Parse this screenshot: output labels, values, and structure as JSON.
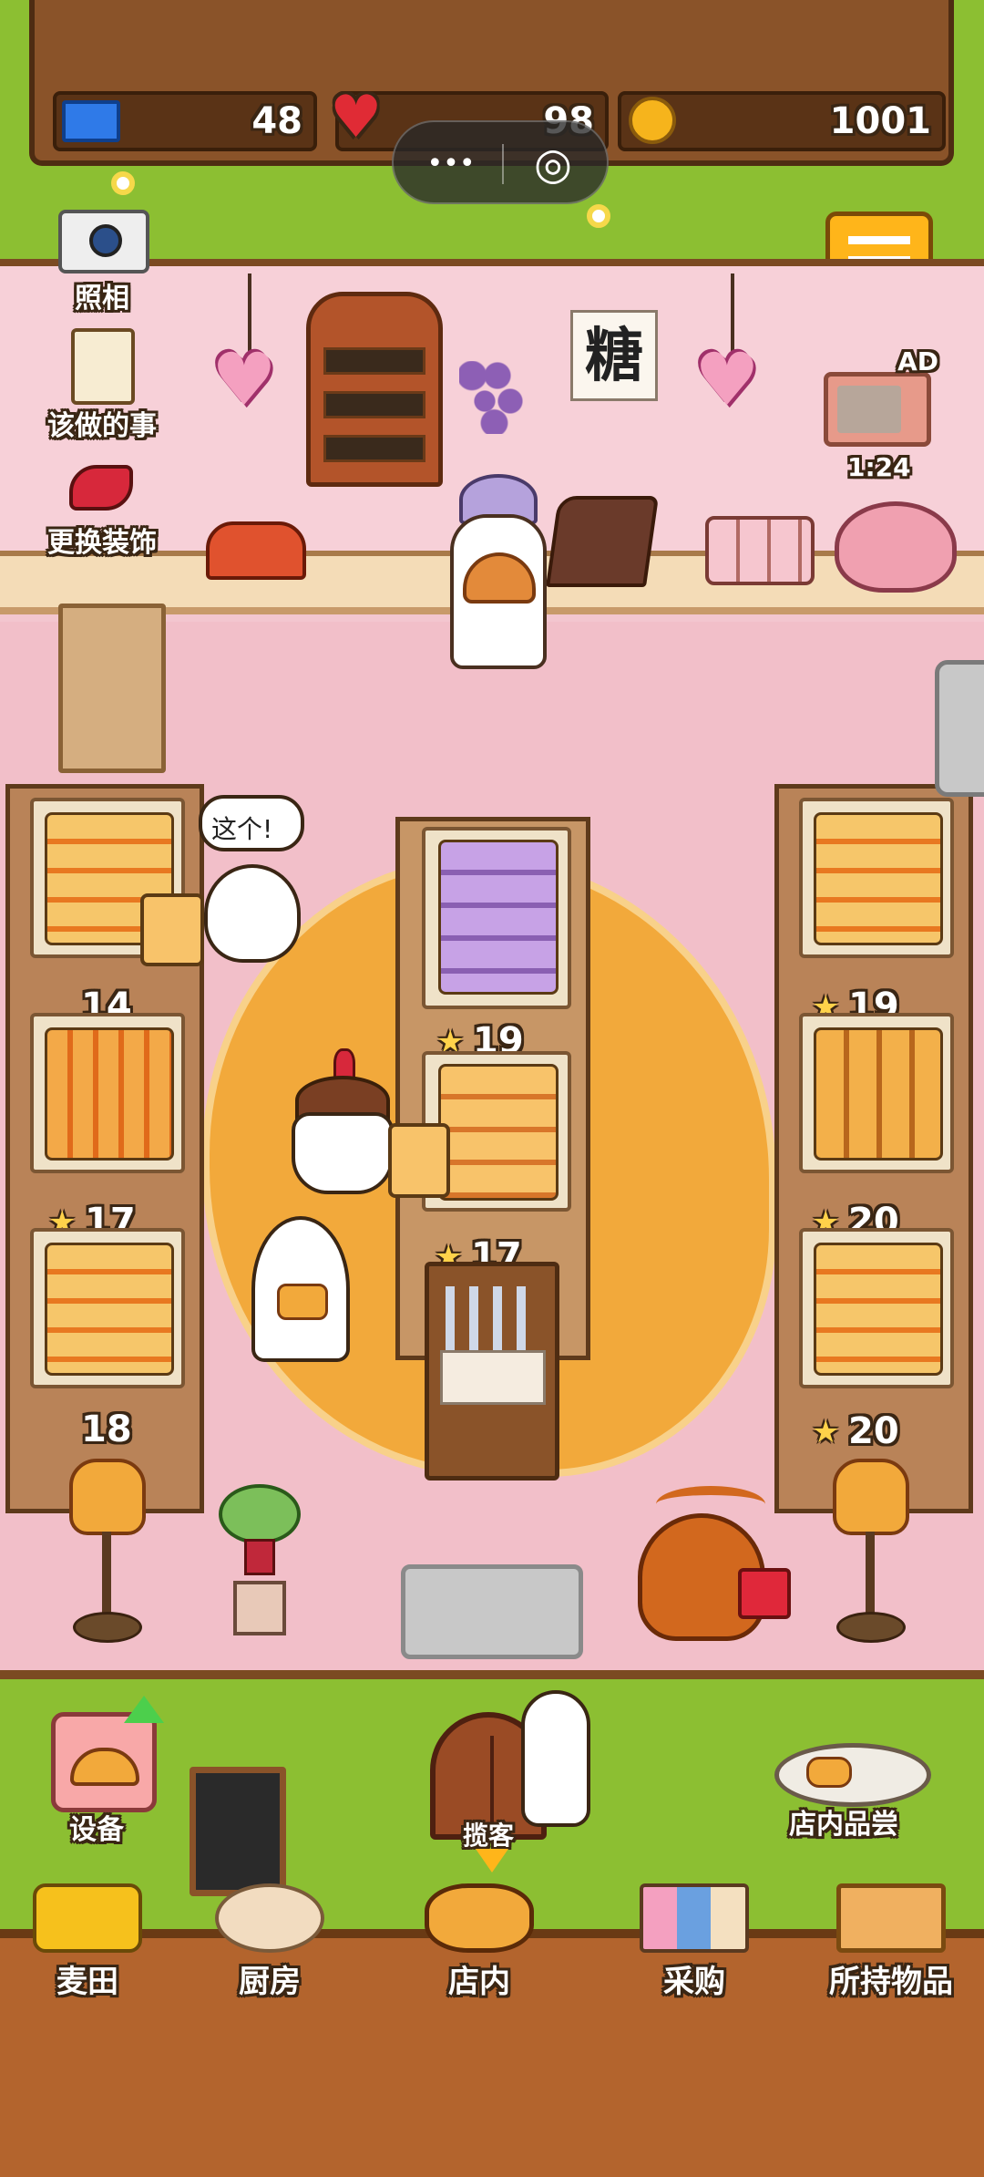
{
  "hud": {
    "tickets": "48",
    "hearts": "98",
    "coins": "1001",
    "icons": [
      "ticket-icon",
      "heart-icon",
      "coin-icon"
    ]
  },
  "miniprogram": {
    "menu_glyph": "•••",
    "close_glyph": "◎"
  },
  "side_menu": {
    "camera_label": "照相",
    "todo_label": "该做的事",
    "decor_label": "更换装饰"
  },
  "shop": {
    "sign_text": "糖",
    "ad_badge": "AD",
    "ad_timer": "1:24",
    "speech_bubble": "这个!"
  },
  "shelf_counts": {
    "left_top": "14",
    "left_mid": "17",
    "left_bottom": "18",
    "center_mid": "19",
    "center_bottom": "17",
    "right_top": "19",
    "right_mid": "20",
    "right_bottom": "20"
  },
  "actions": {
    "equipment_label": "设备",
    "invite_label": "揽客",
    "tasting_label": "店内品尝"
  },
  "bottom_nav": [
    {
      "label": "麦田",
      "icon": "wheat-field-icon"
    },
    {
      "label": "厨房",
      "icon": "kitchen-icon"
    },
    {
      "label": "店内",
      "icon": "bread-basket-icon"
    },
    {
      "label": "采购",
      "icon": "purchase-icon"
    },
    {
      "label": "所持物品",
      "icon": "box-icon"
    }
  ],
  "colors": {
    "wood": "#8a5329",
    "grass": "#8cbf32",
    "wall": "#f7d0d8",
    "floor": "#f2bfc9",
    "rug": "#f2a93b",
    "menu_button": "#ffb51a"
  }
}
